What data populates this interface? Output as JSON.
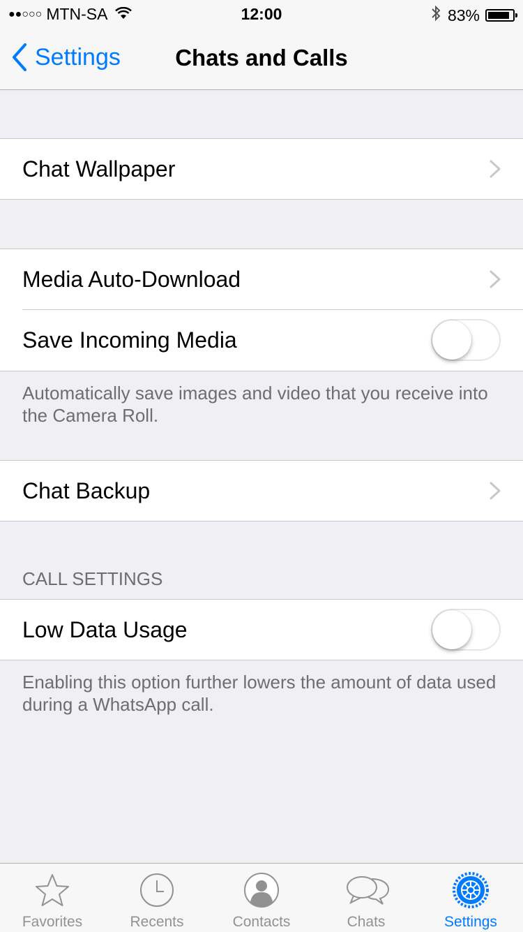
{
  "status_bar": {
    "signal": "●●○○○",
    "carrier": "MTN-SA",
    "time": "12:00",
    "battery": "83%",
    "battery_level": 0.83
  },
  "nav": {
    "back_label": "Settings",
    "title": "Chats and Calls"
  },
  "cells": {
    "chat_wallpaper": "Chat Wallpaper",
    "media_auto_download": "Media Auto-Download",
    "save_incoming_media": "Save Incoming Media",
    "save_incoming_media_on": false,
    "save_incoming_media_footer": "Automatically save images and video that you receive into the Camera Roll.",
    "chat_backup": "Chat Backup",
    "call_settings_header": "CALL SETTINGS",
    "low_data_usage": "Low Data Usage",
    "low_data_usage_on": false,
    "low_data_usage_footer": "Enabling this option further lowers the amount of data used during a WhatsApp call."
  },
  "tabbar": {
    "items": [
      {
        "label": "Favorites",
        "icon": "star-icon"
      },
      {
        "label": "Recents",
        "icon": "clock-icon"
      },
      {
        "label": "Contacts",
        "icon": "person-icon"
      },
      {
        "label": "Chats",
        "icon": "chat-bubbles-icon"
      },
      {
        "label": "Settings",
        "icon": "gear-icon",
        "active": true
      }
    ]
  },
  "colors": {
    "accent": "#007aff",
    "background": "#efeff4",
    "inactive_tab": "#929292"
  }
}
